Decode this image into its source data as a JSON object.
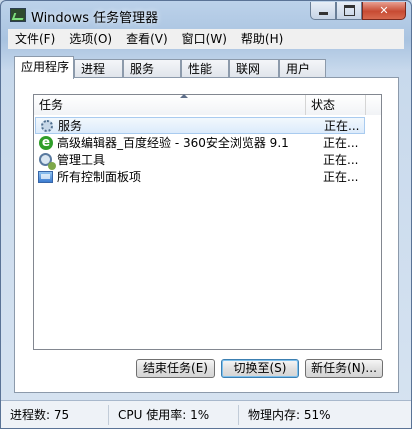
{
  "window": {
    "title": "Windows 任务管理器"
  },
  "menu": [
    "文件(F)",
    "选项(O)",
    "查看(V)",
    "窗口(W)",
    "帮助(H)"
  ],
  "tabs": [
    {
      "label": "应用程序",
      "active": true
    },
    {
      "label": "进程",
      "active": false
    },
    {
      "label": "服务",
      "active": false
    },
    {
      "label": "性能",
      "active": false
    },
    {
      "label": "联网",
      "active": false
    },
    {
      "label": "用户",
      "active": false
    }
  ],
  "list": {
    "columns": {
      "task": "任务",
      "status": "状态"
    },
    "rows": [
      {
        "icon": "gear-icon",
        "name": "服务",
        "status": "正在...",
        "selected": true
      },
      {
        "icon": "browser-e-icon",
        "name": "高级编辑器_百度经验 - 360安全浏览器 9.1",
        "status": "正在...",
        "selected": false
      },
      {
        "icon": "admin-tools-icon",
        "name": "管理工具",
        "status": "正在...",
        "selected": false
      },
      {
        "icon": "control-panel-icon",
        "name": "所有控制面板项",
        "status": "正在...",
        "selected": false
      }
    ]
  },
  "buttons": {
    "end_task": "结束任务(E)",
    "switch_to": "切换至(S)",
    "new_task": "新任务(N)..."
  },
  "statusbar": {
    "processes": "进程数: 75",
    "cpu": "CPU 使用率: 1%",
    "memory": "物理内存: 51%"
  }
}
